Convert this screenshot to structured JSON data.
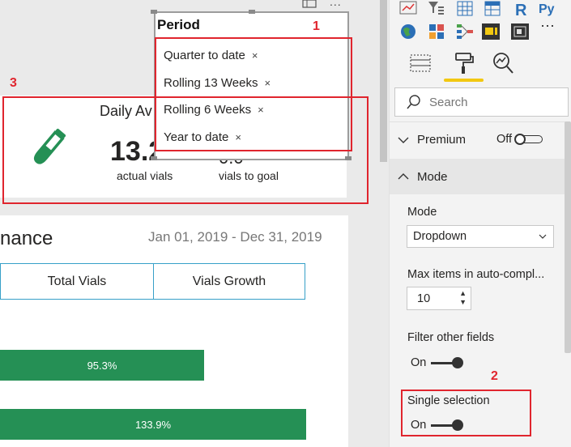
{
  "canvas": {
    "daily_card": {
      "title": "Daily Av",
      "value": "13.2",
      "value_label": "actual vials",
      "goal_value": "0.0",
      "goal_label": "vials to goal"
    },
    "performance_card": {
      "title": "nance",
      "date_range": "Jan 01, 2019 - Dec 31, 2019",
      "buttons": [
        "Total Vials",
        "Vials Growth"
      ],
      "bars": [
        {
          "label": "95.3%",
          "value": 95.3
        },
        {
          "label": "133.9%",
          "value": 133.9
        }
      ]
    },
    "slicer": {
      "title": "Period",
      "items": [
        "Quarter to date",
        "Rolling 13 Weeks",
        "Rolling 6 Weeks",
        "Year to date"
      ],
      "remove_glyph": "×",
      "more_glyph": "..."
    }
  },
  "pane": {
    "viz_more": "⋯",
    "search": {
      "placeholder": "Search"
    },
    "sections": {
      "premium": {
        "label": "Premium",
        "toggle_label": "Off"
      },
      "mode": {
        "label": "Mode"
      }
    },
    "mode_label": "Mode",
    "mode_value": "Dropdown",
    "max_items_label": "Max items in auto-compl...",
    "max_items_value": "10",
    "filter_other_label": "Filter other fields",
    "filter_other_toggle": "On",
    "single_selection_label": "Single selection",
    "single_selection_toggle": "On"
  },
  "annotations": [
    "1",
    "2",
    "3"
  ],
  "colors": {
    "accent_green": "#259055",
    "annotation_red": "#e0252e",
    "tab_yellow": "#f2c811",
    "button_border": "#37a0c8"
  }
}
